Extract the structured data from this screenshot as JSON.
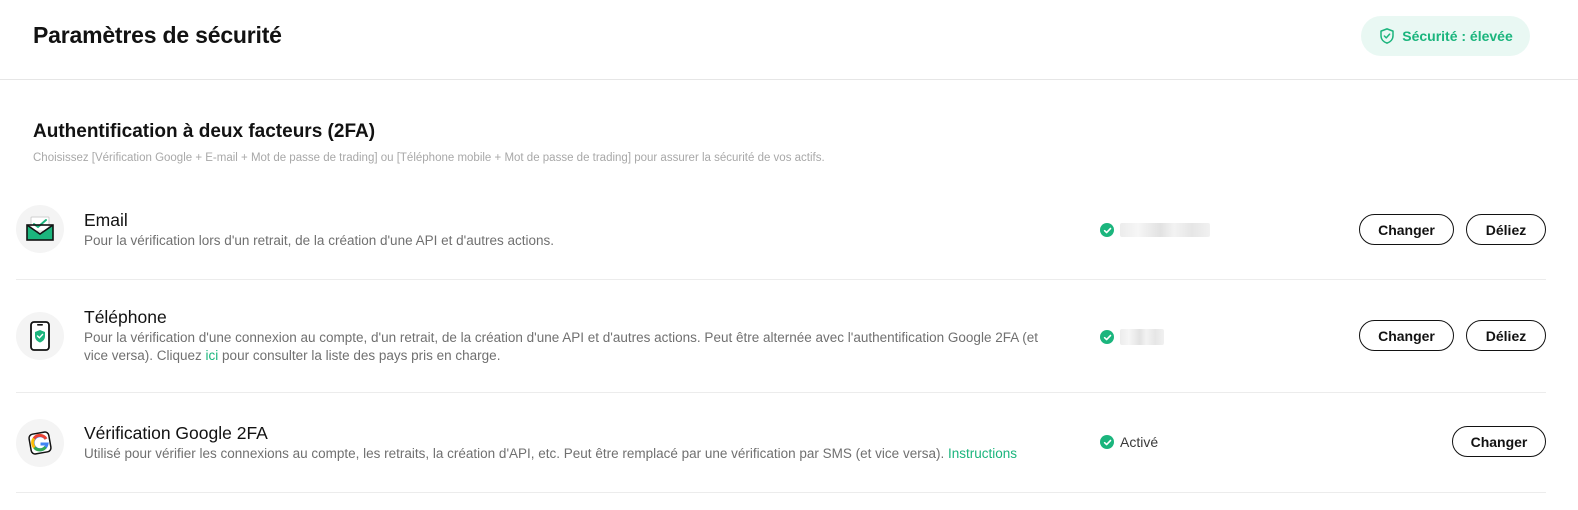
{
  "header": {
    "title": "Paramètres de sécurité",
    "security_badge": "Sécurité : élevée"
  },
  "section": {
    "title": "Authentification à deux facteurs (2FA)",
    "subtitle": "Choisissez [Vérification Google + E-mail + Mot de passe de trading] ou [Téléphone mobile + Mot de passe de trading] pour assurer la sécurité de vos actifs."
  },
  "colors": {
    "accent": "#1bb57d",
    "badge_bg": "#e9f8f3",
    "divider": "#ececec"
  },
  "items": [
    {
      "icon": "envelope-icon",
      "title": "Email",
      "description": "Pour la vérification lors d'un retrait, de la création d'une API et d'autres actions.",
      "status_text": "",
      "status_masked": true,
      "buttons": {
        "change": "Changer",
        "unlink": "Déliez"
      }
    },
    {
      "icon": "phone-shield-icon",
      "title": "Téléphone",
      "description_before_link": "Pour la vérification d'une connexion au compte, d'un retrait, de la création d'une API et d'autres actions. Peut être alternée avec l'authentification Google 2FA (et vice versa). Cliquez ",
      "link": "ici",
      "description_after_link": " pour consulter la liste des pays pris en charge.",
      "status_text": "",
      "status_masked": true,
      "buttons": {
        "change": "Changer",
        "unlink": "Déliez"
      }
    },
    {
      "icon": "google-icon",
      "title": "Vérification Google 2FA",
      "description_before_link": "Utilisé pour vérifier les connexions au compte, les retraits, la création d'API, etc. Peut être remplacé par une vérification par SMS (et vice versa). ",
      "link": "Instructions",
      "status_text": "Activé",
      "status_masked": false,
      "buttons": {
        "change": "Changer"
      }
    }
  ]
}
